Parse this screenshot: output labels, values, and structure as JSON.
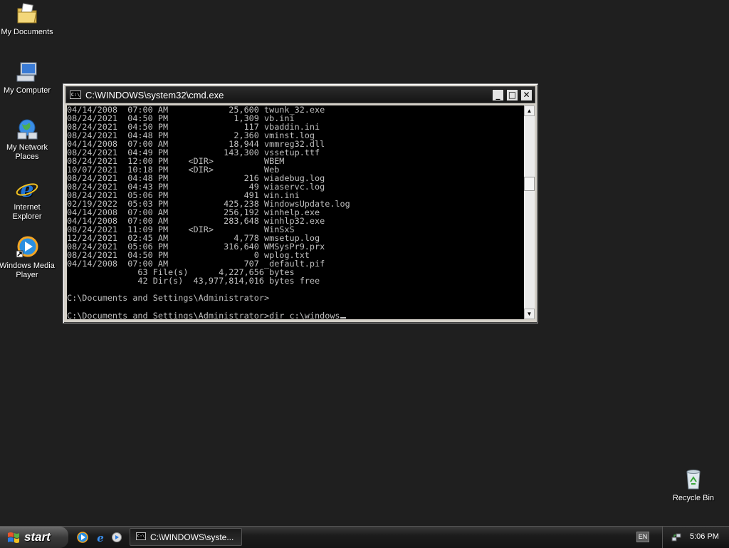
{
  "desktop": {
    "icons": [
      {
        "label": "My Documents",
        "icon": "my-documents-icon"
      },
      {
        "label": "My Computer",
        "icon": "my-computer-icon"
      },
      {
        "label": "My Network Places",
        "icon": "network-places-icon"
      },
      {
        "label": "Internet Explorer",
        "icon": "internet-explorer-icon"
      },
      {
        "label": "Windows Media Player",
        "icon": "media-player-icon"
      },
      {
        "label": "Recycle Bin",
        "icon": "recycle-bin-icon"
      }
    ]
  },
  "cmd_window": {
    "title": "C:\\WINDOWS\\system32\\cmd.exe",
    "icon_text": "C:\\",
    "buttons": {
      "minimize": "_",
      "maximize": "□",
      "close": "✕"
    },
    "console_lines": [
      "04/14/2008  07:00 AM            25,600 twunk_32.exe",
      "08/24/2021  04:50 PM             1,309 vb.ini",
      "08/24/2021  04:50 PM               117 vbaddin.ini",
      "08/24/2021  04:48 PM             2,360 vminst.log",
      "04/14/2008  07:00 AM            18,944 vmmreg32.dll",
      "08/24/2021  04:49 PM           143,300 vssetup.ttf",
      "08/24/2021  12:00 PM    <DIR>          WBEM",
      "10/07/2021  10:18 PM    <DIR>          Web",
      "08/24/2021  04:48 PM               216 wiadebug.log",
      "08/24/2021  04:43 PM                49 wiaservc.log",
      "08/24/2021  05:06 PM               491 win.ini",
      "02/19/2022  05:03 PM           425,238 WindowsUpdate.log",
      "04/14/2008  07:00 AM           256,192 winhelp.exe",
      "04/14/2008  07:00 AM           283,648 winhlp32.exe",
      "08/24/2021  11:09 PM    <DIR>          WinSxS",
      "12/24/2021  02:45 AM             4,778 wmsetup.log",
      "08/24/2021  05:06 PM           316,640 WMSysPr9.prx",
      "08/24/2021  04:50 PM                 0 wplog.txt",
      "04/14/2008  07:00 AM               707 _default.pif",
      "              63 File(s)      4,227,656 bytes",
      "              42 Dir(s)  43,977,814,016 bytes free",
      "",
      "C:\\Documents and Settings\\Administrator>",
      ""
    ],
    "prompt_line": "C:\\Documents and Settings\\Administrator>dir c:\\windows"
  },
  "taskbar": {
    "start_label": "start",
    "quick_launch": [
      "media-player-icon",
      "internet-explorer-icon",
      "show-desktop-icon"
    ],
    "tasks": [
      {
        "label": "C:\\WINDOWS\\syste..."
      }
    ],
    "language": "EN",
    "clock": "5:06 PM"
  }
}
